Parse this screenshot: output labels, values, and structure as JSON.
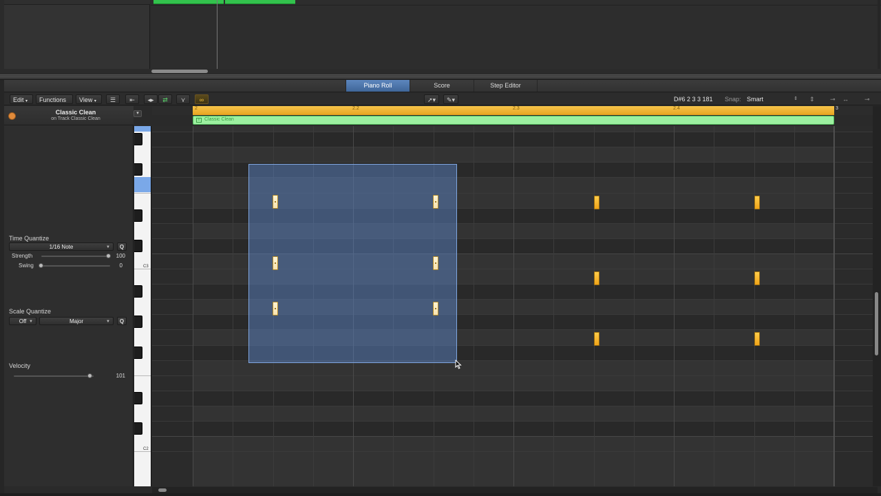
{
  "editor_tabs": [
    {
      "label": "Piano Roll",
      "active": true
    },
    {
      "label": "Score",
      "active": false
    },
    {
      "label": "Step Editor",
      "active": false
    }
  ],
  "toolbar": {
    "edit": "Edit",
    "functions": "Functions",
    "view": "View",
    "position": "D#6  2 3 3 181",
    "snap_label": "Snap:",
    "snap_value": "Smart"
  },
  "inspector": {
    "title": "Classic Clean",
    "subtitle": "on Track Classic Clean",
    "time_quantize": {
      "label": "Time Quantize",
      "value": "1/16 Note",
      "q": "Q",
      "strength_label": "Strength",
      "strength_value": "100",
      "swing_label": "Swing",
      "swing_value": "0"
    },
    "scale_quantize": {
      "label": "Scale Quantize",
      "mode": "Off",
      "scale": "Major",
      "q": "Q"
    },
    "velocity": {
      "label": "Velocity",
      "value": "101"
    }
  },
  "keyboard": {
    "labels": [
      "C3",
      "C2"
    ]
  },
  "ruler": {
    "labels": [
      "2",
      "2.2",
      "2.3",
      "2.4",
      "3"
    ]
  },
  "region": {
    "name": "Classic Clean"
  },
  "colors": {
    "note": "#f0a419",
    "note_selected": "#f7e3b0",
    "region": "#9cf0a0",
    "ruler": "#f6c34a",
    "selection": "#608cd2",
    "tab_active": "#4f76ab"
  }
}
